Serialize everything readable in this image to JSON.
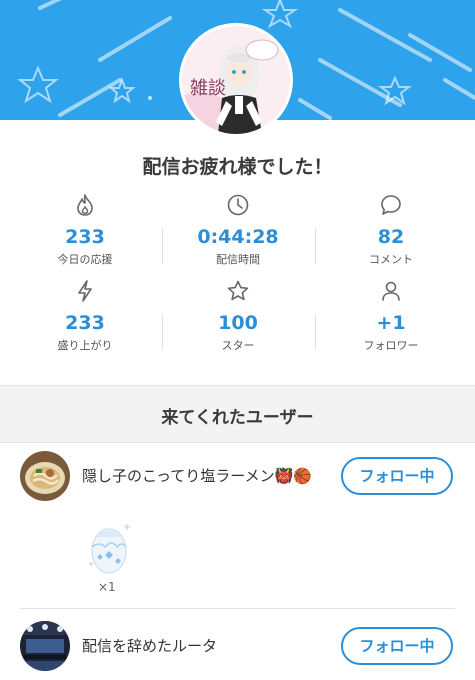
{
  "header": {
    "title": "配信お疲れ様でした！",
    "avatar_text": "雑談",
    "banner_color": "#2fa2ec"
  },
  "stats": [
    {
      "icon": "flame-icon",
      "value": "233",
      "label": "今日の応援"
    },
    {
      "icon": "clock-icon",
      "value": "0:44:28",
      "label": "配信時間"
    },
    {
      "icon": "comment-icon",
      "value": "82",
      "label": "コメント"
    },
    {
      "icon": "lightning-icon",
      "value": "233",
      "label": "盛り上がり"
    },
    {
      "icon": "star-icon",
      "value": "100",
      "label": "スター"
    },
    {
      "icon": "person-icon",
      "value": "+1",
      "label": "フォロワー"
    }
  ],
  "visitors": {
    "title": "来てくれたユーザー",
    "users": [
      {
        "name": "隠し子のこってり塩ラーメン👹🏀",
        "button": "フォロー中",
        "gift_count": "×1"
      },
      {
        "name": "配信を辞めたルータ",
        "button": "フォロー中"
      }
    ]
  },
  "colors": {
    "accent": "#2a8fd8",
    "section_bg": "#f3f3f4"
  }
}
